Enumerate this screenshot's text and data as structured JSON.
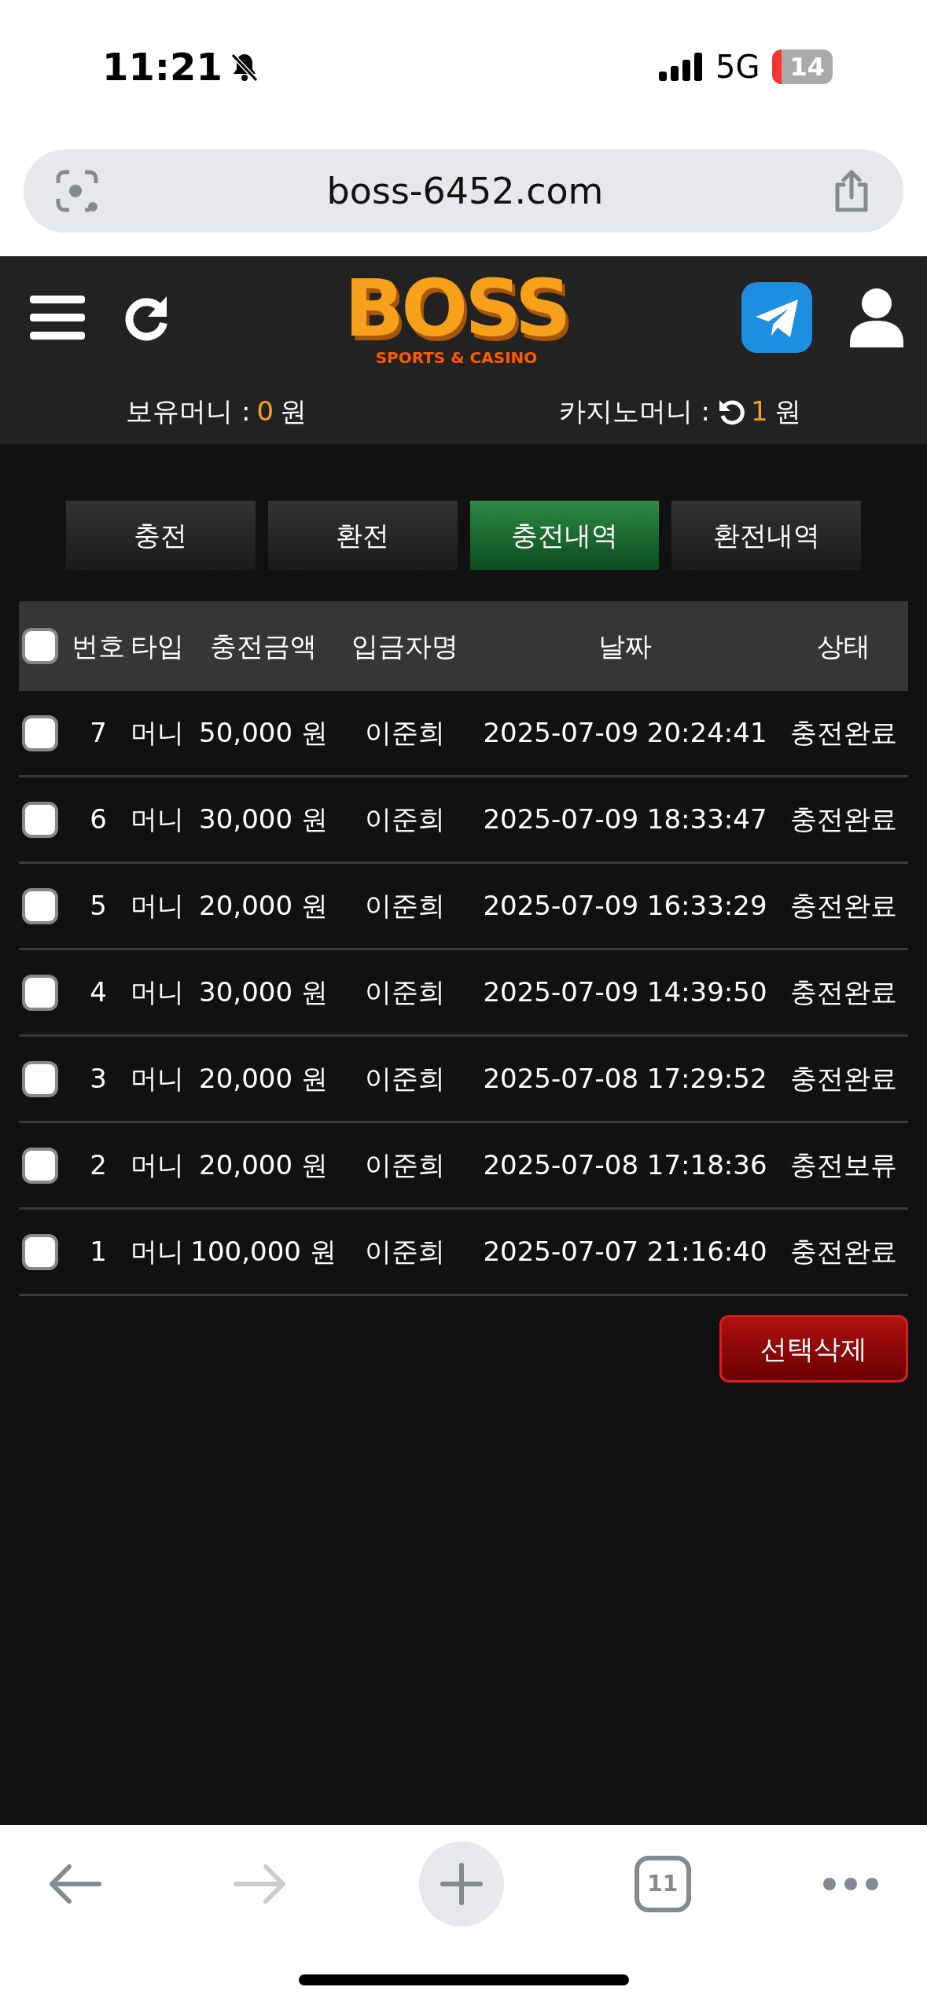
{
  "status_bar": {
    "time": "11:21",
    "network": "5G",
    "battery": "14"
  },
  "browser": {
    "url": "boss-6452.com",
    "tab_count": "11"
  },
  "header": {
    "logo": {
      "title": "BOSS",
      "subtitle": "SPORTS & CASINO"
    }
  },
  "balances": [
    {
      "kind": "plain",
      "label": "보유머니 :",
      "value": "0",
      "unit": "원"
    },
    {
      "kind": "refresh",
      "label": "카지노머니 :",
      "value": "1",
      "unit": "원"
    }
  ],
  "tabs": [
    {
      "label": "충전",
      "selected": false
    },
    {
      "label": "환전",
      "selected": false
    },
    {
      "label": "충전내역",
      "selected": true
    },
    {
      "label": "환전내역",
      "selected": false
    }
  ],
  "table": {
    "select_all_checked": false,
    "columns": [
      "번호",
      "타입",
      "충전금액",
      "입금자명",
      "날짜",
      "상태"
    ],
    "rows": [
      {
        "checked": false,
        "cells": [
          "7",
          "머니",
          "50,000 원",
          "이준희",
          "2025-07-09 20:24:41",
          "충전완료"
        ]
      },
      {
        "checked": false,
        "cells": [
          "6",
          "머니",
          "30,000 원",
          "이준희",
          "2025-07-09 18:33:47",
          "충전완료"
        ]
      },
      {
        "checked": false,
        "cells": [
          "5",
          "머니",
          "20,000 원",
          "이준희",
          "2025-07-09 16:33:29",
          "충전완료"
        ]
      },
      {
        "checked": false,
        "cells": [
          "4",
          "머니",
          "30,000 원",
          "이준희",
          "2025-07-09 14:39:50",
          "충전완료"
        ]
      },
      {
        "checked": false,
        "cells": [
          "3",
          "머니",
          "20,000 원",
          "이준희",
          "2025-07-08 17:29:52",
          "충전완료"
        ]
      },
      {
        "checked": false,
        "cells": [
          "2",
          "머니",
          "20,000 원",
          "이준희",
          "2025-07-08 17:18:36",
          "충전보류"
        ]
      },
      {
        "checked": false,
        "cells": [
          "1",
          "머니",
          "100,000 원",
          "이준희",
          "2025-07-07 21:16:40",
          "충전완료"
        ]
      }
    ]
  },
  "delete_button": "선택삭제"
}
